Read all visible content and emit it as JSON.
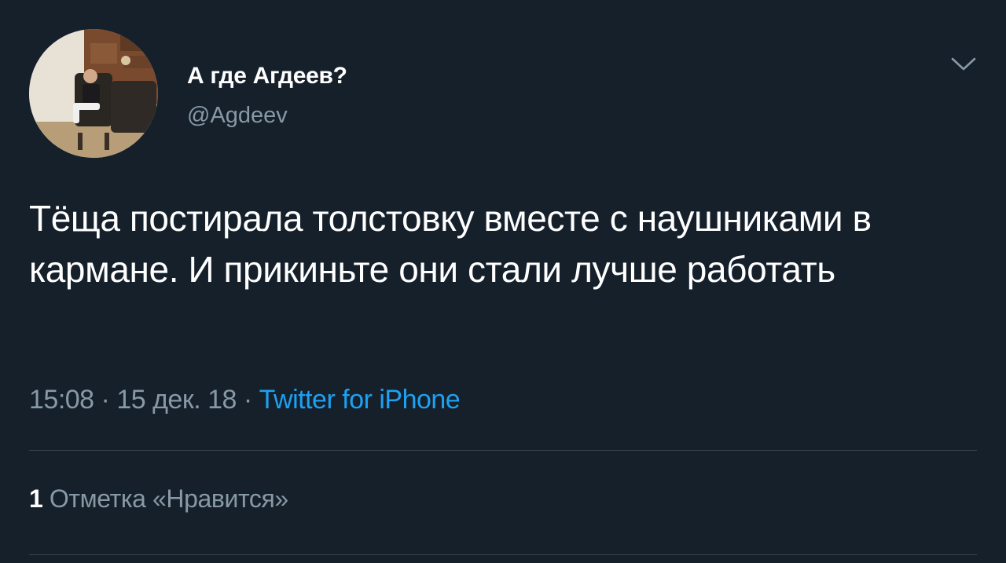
{
  "user": {
    "display_name": "А где Агдеев?",
    "handle": "@Agdeev",
    "avatar_icon": "profile-photo"
  },
  "menu": {
    "icon": "chevron-down-icon"
  },
  "tweet": {
    "text": "Тёща постирала толстовку вместе с наушниками в кармане. И прикиньте они стали лучше работать",
    "time": "15:08",
    "date": "15 дек. 18",
    "separator": " · ",
    "source": "Twitter for iPhone"
  },
  "stats": {
    "likes_count": "1",
    "likes_label": "Отметка «Нравится»"
  },
  "colors": {
    "background": "#15202b",
    "primary_text": "#ffffff",
    "secondary_text": "#8899a6",
    "link": "#1da1f2",
    "divider": "#38444d"
  }
}
